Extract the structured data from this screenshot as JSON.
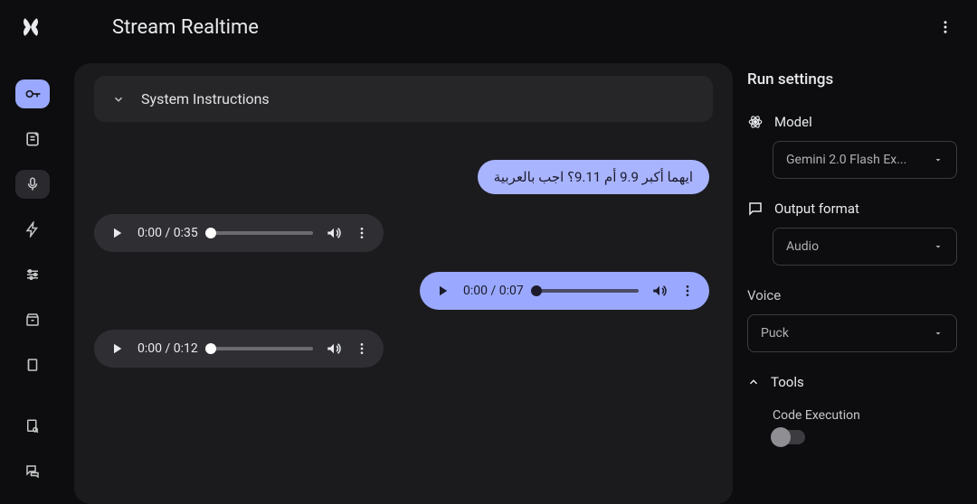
{
  "header": {
    "title": "Stream Realtime"
  },
  "systemInstructions": {
    "label": "System Instructions"
  },
  "messages": {
    "userText": "ايهما أكبر 9.9 أم 9.11؟ اجب بالعربية",
    "audio1": {
      "current": "0:00",
      "total": "0:35"
    },
    "audio2": {
      "current": "0:00",
      "total": "0:07"
    },
    "audio3": {
      "current": "0:00",
      "total": "0:12"
    }
  },
  "settings": {
    "title": "Run settings",
    "modelLabel": "Model",
    "modelValue": "Gemini 2.0 Flash Ex...",
    "outputFormatLabel": "Output format",
    "outputFormatValue": "Audio",
    "voiceLabel": "Voice",
    "voiceValue": "Puck",
    "toolsLabel": "Tools",
    "codeExecLabel": "Code Execution"
  }
}
